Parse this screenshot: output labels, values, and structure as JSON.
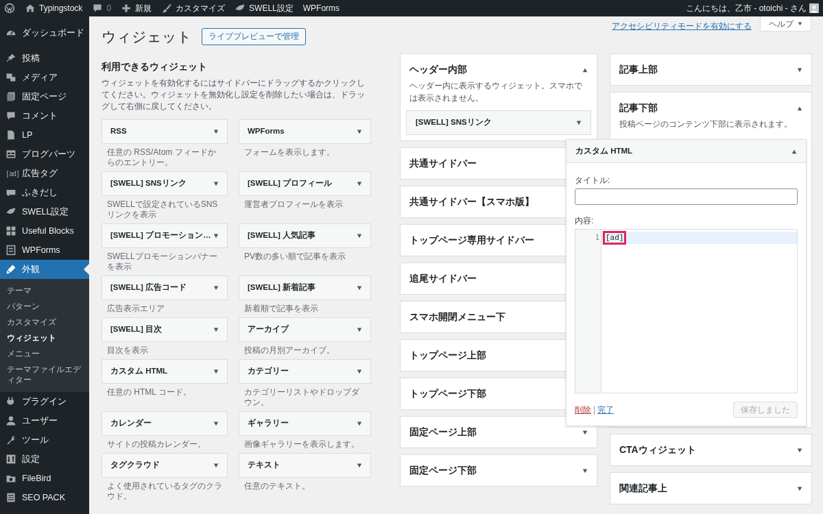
{
  "admin_bar": {
    "items": [
      {
        "kind": "wp-logo"
      },
      {
        "kind": "home",
        "label": "Typingstock"
      },
      {
        "kind": "comments",
        "label": "0"
      },
      {
        "kind": "plus",
        "label": "新規"
      },
      {
        "kind": "brush",
        "label": "カスタマイズ"
      },
      {
        "kind": "leaf",
        "label": "SWELL設定"
      },
      {
        "kind": "text",
        "label": "WPForms"
      }
    ],
    "greeting": "こんにちは、乙市 - otoichi - さん"
  },
  "sidebar": {
    "menu": [
      {
        "label": "ダッシュボード",
        "selected": false
      },
      {
        "label": "投稿",
        "selected": false
      },
      {
        "label": "メディア",
        "selected": false
      },
      {
        "label": "固定ページ",
        "selected": false
      },
      {
        "label": "コメント",
        "selected": false
      },
      {
        "label": "LP",
        "selected": false
      },
      {
        "label": "ブログパーツ",
        "selected": false
      },
      {
        "label": "広告タグ",
        "selected": false,
        "icon_text": "[ad]"
      },
      {
        "label": "ふきだし",
        "selected": false
      },
      {
        "label": "SWELL設定",
        "selected": false
      },
      {
        "label": "Useful Blocks",
        "selected": false
      },
      {
        "label": "WPForms",
        "selected": false
      },
      {
        "label": "外観",
        "selected": true,
        "children": [
          {
            "label": "テーマ",
            "selected": false
          },
          {
            "label": "パターン",
            "selected": false
          },
          {
            "label": "カスタマイズ",
            "selected": false
          },
          {
            "label": "ウィジェット",
            "selected": true
          },
          {
            "label": "メニュー",
            "selected": false
          },
          {
            "label": "テーマファイルエディター",
            "selected": false
          }
        ]
      },
      {
        "label": "プラグイン",
        "selected": false
      },
      {
        "label": "ユーザー",
        "selected": false
      },
      {
        "label": "ツール",
        "selected": false
      },
      {
        "label": "設定",
        "selected": false
      },
      {
        "label": "FileBird",
        "selected": false
      },
      {
        "label": "SEO PACK",
        "selected": false
      }
    ]
  },
  "page": {
    "title": "ウィジェット",
    "live_preview_button": "ライブプレビューで管理",
    "accessibility_link": "アクセシビリティモードを有効にする",
    "help_button": "ヘルプ"
  },
  "available_widgets": {
    "heading": "利用できるウィジェット",
    "description": "ウィジェットを有効化するにはサイドバーにドラッグするかクリックしてください。ウィジェットを無効化し設定を削除したい場合は、ドラッグして右側に戻してください。",
    "widgets": [
      {
        "title": "RSS",
        "description": "任意の RSS/Atom フィードからのエントリー。"
      },
      {
        "title": "WPForms",
        "description": "フォームを表示します。"
      },
      {
        "title": "[SWELL] SNSリンク",
        "description": "SWELLで設定されているSNSリンクを表示"
      },
      {
        "title": "[SWELL] プロフィール",
        "description": "運営者プロフィールを表示"
      },
      {
        "title": "[SWELL] プロモーション…",
        "description": "SWELLプロモーションバナーを表示"
      },
      {
        "title": "[SWELL] 人気記事",
        "description": "PV数の多い順で記事を表示"
      },
      {
        "title": "[SWELL] 広告コード",
        "description": "広告表示エリア"
      },
      {
        "title": "[SWELL] 新着記事",
        "description": "新着順で記事を表示"
      },
      {
        "title": "[SWELL] 目次",
        "description": "目次を表示"
      },
      {
        "title": "アーカイブ",
        "description": "投稿の月別アーカイブ。"
      },
      {
        "title": "カスタム HTML",
        "description": "任意の HTML コード。"
      },
      {
        "title": "カテゴリー",
        "description": "カテゴリーリストやドロップダウン。"
      },
      {
        "title": "カレンダー",
        "description": "サイトの投稿カレンダー。"
      },
      {
        "title": "ギャラリー",
        "description": "画像ギャラリーを表示します。"
      },
      {
        "title": "タグクラウド",
        "description": "よく使用されているタグのクラウド。"
      },
      {
        "title": "テキスト",
        "description": "任意のテキスト。"
      }
    ]
  },
  "widget_areas": {
    "column_1": [
      {
        "title": "ヘッダー内部",
        "expanded": true,
        "covered": false,
        "description": "ヘッダー内に表示するウィジェット。スマホでは表示されません。",
        "widgets": [
          {
            "title": "[SWELL] SNSリンク"
          }
        ]
      },
      {
        "title": "共通サイドバー",
        "expanded": false,
        "covered": true
      },
      {
        "title": "共通サイドバー【スマホ版】",
        "expanded": false,
        "covered": true
      },
      {
        "title": "トップページ専用サイドバー",
        "expanded": false,
        "covered": true
      },
      {
        "title": "追尾サイドバー",
        "expanded": false,
        "covered": true
      },
      {
        "title": "スマホ開閉メニュー下",
        "expanded": false,
        "covered": true
      },
      {
        "title": "トップページ上部",
        "expanded": false,
        "covered": true
      },
      {
        "title": "トップページ下部",
        "expanded": false,
        "covered": true
      },
      {
        "title": "固定ページ上部",
        "expanded": false,
        "covered": false
      },
      {
        "title": "固定ページ下部",
        "expanded": false,
        "covered": false
      }
    ],
    "column_2": [
      {
        "title": "記事上部",
        "expanded": false,
        "covered": false
      },
      {
        "title": "記事下部",
        "expanded": true,
        "covered": false,
        "description": "投稿ページのコンテンツ下部に表示されます。"
      },
      {
        "title": "CTAウィジェット",
        "expanded": false,
        "covered": false
      },
      {
        "title": "関連記事上",
        "expanded": false,
        "covered": false
      }
    ]
  },
  "open_widget": {
    "title": "カスタム HTML",
    "expanded": true,
    "title_label": "タイトル:",
    "content_label": "内容:",
    "code_lines": [
      {
        "number": "1",
        "text": "[ad]",
        "highlighted": true,
        "marked": true
      }
    ],
    "delete_link": "削除",
    "link_separator": "|",
    "done_link": "完了",
    "save_button": {
      "label": "保存しました",
      "disabled": true
    }
  }
}
